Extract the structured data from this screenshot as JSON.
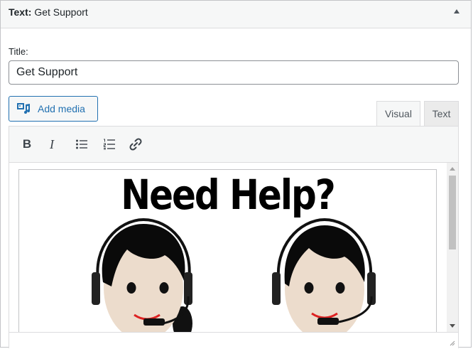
{
  "widget": {
    "title_prefix": "Text:",
    "title_name": "Get Support"
  },
  "form": {
    "title_label": "Title:",
    "title_value": "Get Support"
  },
  "editor": {
    "add_media_label": "Add media",
    "tabs": [
      {
        "label": "Visual",
        "active": true
      },
      {
        "label": "Text",
        "active": false
      }
    ],
    "toolbar": {
      "bold_label": "B",
      "italic_label": "I",
      "icons": [
        "bold-icon",
        "italic-icon",
        "bulleted-list-icon",
        "numbered-list-icon",
        "link-icon"
      ]
    },
    "image_heading": "Need Help?"
  },
  "colors": {
    "accent": "#2271b1",
    "border": "#c3c4c7",
    "header_bg": "#f6f7f7"
  }
}
